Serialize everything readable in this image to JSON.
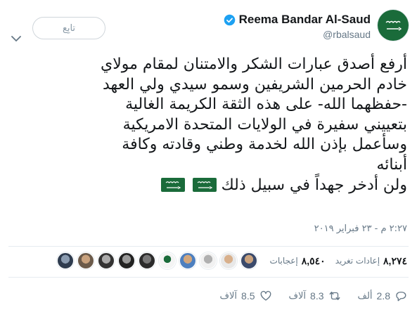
{
  "tweet": {
    "author": {
      "display_name": "Reema Bandar Al-Saud",
      "handle": "@rbalsaud",
      "avatar_icon": "saudi-flag-avatar-icon",
      "verified_icon": "verified-badge-icon",
      "brand_color": "#1da1f2",
      "flag_green": "#1a6b3a"
    },
    "follow_button_label": "تابِع",
    "text_lines": [
      "أرفع أصدق عبارات الشكر والامتنان لمقام مولاي",
      "خادم الحرمين الشريفين وسمو سيدي ولي العهد",
      "-حفظهما الله- على هذه الثقة  الكريمة الغالية",
      "بتعييني سفيرة  في الولايات المتحدة الامريكية",
      "وسأعمل بإذن الله لخدمة وطني وقادته وكافة",
      "أبنائه",
      "ولن أدخر جهداً في سبيل ذلك"
    ],
    "flag_emoji_count": 2,
    "timestamp": "٢:٢٧ م - ٢٣ فبراير ٢٠١٩",
    "stats": {
      "retweets_count": "٨,٢٧٤",
      "retweets_label": "إعادات تغريد",
      "likes_count": "٨,٥٤٠",
      "likes_label": "إعجابات"
    },
    "actions": {
      "reply_count": "2.8",
      "reply_unit": "ألف",
      "retweet_count": "8.3",
      "retweet_unit": "آلاف",
      "like_count": "8.5",
      "like_unit": "آلاف"
    }
  }
}
